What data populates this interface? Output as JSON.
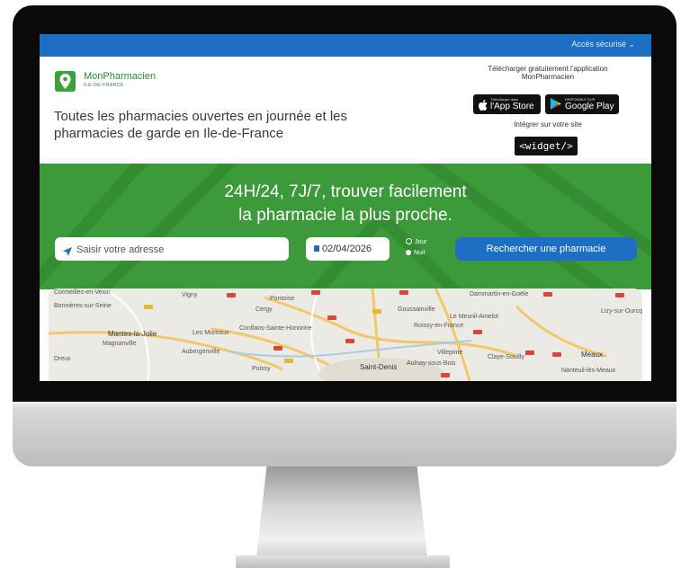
{
  "topbar": {
    "secure_access": "Accès sécurisé ⌄"
  },
  "brand": {
    "name": "MonPharmacien",
    "region": "ILE-DE-FRANCE"
  },
  "tagline": "Toutes les pharmacies ouvertes en journée et les pharmacies de garde en Ile-de-France",
  "download": {
    "line1": "Télécharger gratuitement l'application",
    "line2": "MonPharmacien"
  },
  "app_store": {
    "small": "Télécharger dans",
    "label": "l'App Store"
  },
  "google_play": {
    "small": "DISPONIBLE SUR",
    "label": "Google Play"
  },
  "integrate": "Intégrer sur votre site",
  "widget": "<widget/>",
  "hero": {
    "line1": "24H/24, 7J/7, trouver facilement",
    "line2": "la pharmacie la plus proche."
  },
  "search": {
    "address_placeholder": "Saisir votre adresse",
    "date": "02/04/2026",
    "option_day": "Jour",
    "option_night": "Nuit",
    "button": "Rechercher une pharmacie"
  },
  "map_labels": {
    "pontoise": "Pontoise",
    "cergy": "Cergy",
    "mantes": "Mantes-la-Jolie",
    "saint_denis": "Saint-Denis",
    "aulnay": "Aulnay-sous-Bois",
    "meaux": "Meaux",
    "gonesse": "Goussainville",
    "magny": "Magnanville",
    "dreux": "Dreux",
    "poissy": "Poissy",
    "villepinte": "Villepinte",
    "dammartin": "Dammartin-en-Goële",
    "ferte": "Lizy-sur-Ourcq",
    "cormeilles": "Cormeilles-en-Vexin",
    "mesnil": "Le Mesnil-Amelot",
    "chelles": "Claye-Souilly",
    "conflans": "Conflans-Sainte-Honorine",
    "mureaux": "Les Mureaux",
    "aubergenville": "Aubergenville",
    "vigny": "Vigny",
    "bonnieres": "Bonnières-sur-Seine",
    "roissy": "Roissy-en-France",
    "nanteuil": "Nanteuil-lès-Meaux"
  },
  "colors": {
    "blue": "#1d6fc4",
    "green": "#3c9a3a",
    "logo_green": "#39a33a"
  }
}
